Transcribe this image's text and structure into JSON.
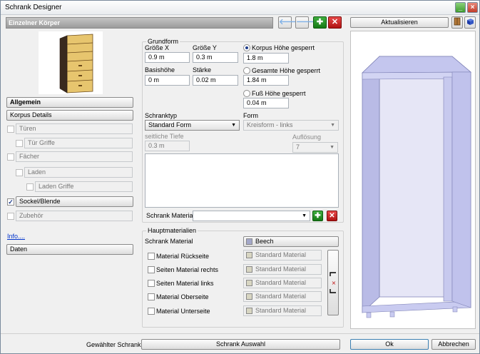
{
  "window": {
    "title": "Schrank Designer"
  },
  "header": {
    "title": "Einzelner Körper"
  },
  "toolbar": {
    "back": "🡐",
    "forward": "🡒",
    "add": "✚",
    "remove": "✕"
  },
  "sidebar": {
    "allgemein": "Allgemein",
    "korpus_details": "Korpus Details",
    "items": [
      {
        "label": "Türen",
        "checked": false
      },
      {
        "label": "Tür Griffe",
        "checked": false
      },
      {
        "label": "Fächer",
        "checked": false
      },
      {
        "label": "Laden",
        "checked": false
      },
      {
        "label": "Laden Griffe",
        "checked": false
      },
      {
        "label": "Sockel/Blende",
        "checked": true
      },
      {
        "label": "Zubehör",
        "checked": false
      }
    ],
    "info_link": "Info....",
    "daten": "Daten"
  },
  "grundform": {
    "title": "Grundform",
    "groesse_x_label": "Größe X",
    "groesse_x": "0.9 m",
    "groesse_y_label": "Größe Y",
    "groesse_y": "0.3 m",
    "basishoehe_label": "Basishöhe",
    "basishoehe": "0 m",
    "staerke_label": "Stärke",
    "staerke": "0.02 m",
    "radio_korpus": "Korpus Höhe gesperrt",
    "korpus_value": "1.8 m",
    "radio_gesamt": "Gesamte Höhe gesperrt",
    "gesamt_value": "1.84 m",
    "radio_fuss": "Fuß Höhe gesperrt",
    "fuss_value": "0.04 m",
    "schranktyp_label": "Schranktyp",
    "schranktyp": "Standard Form",
    "form_label": "Form",
    "form": "Kreisform - links",
    "seitliche_tiefe_label": "seitliche Tiefe",
    "seitliche_tiefe": "0.3 m",
    "aufloesung_label": "Auflösung",
    "aufloesung": "7",
    "schrank_material_label": "Schrank Material",
    "schrank_material": ""
  },
  "hauptmaterialien": {
    "title": "Hauptmaterialien",
    "schrank_material_label": "Schrank Material",
    "schrank_material": "Beech",
    "rows": [
      {
        "label": "Material Rückseite",
        "value": "Standard Material"
      },
      {
        "label": "Seiten Material rechts",
        "value": "Standard Material"
      },
      {
        "label": "Seiten Material links",
        "value": "Standard Material"
      },
      {
        "label": "Material Oberseite",
        "value": "Standard Material"
      },
      {
        "label": "Material Unterseite",
        "value": "Standard Material"
      }
    ]
  },
  "preview": {
    "aktualisieren": "Aktualisieren"
  },
  "footer": {
    "gewaehlter_label": "Gewählter Schrank:",
    "schrank_auswahl": "Schrank Auswahl",
    "ok": "Ok",
    "abbrechen": "Abbrechen"
  },
  "colors": {
    "beech": "#a4a8c9",
    "standard": "#d8d6c2",
    "preview_fill": "#c7c9ee"
  }
}
